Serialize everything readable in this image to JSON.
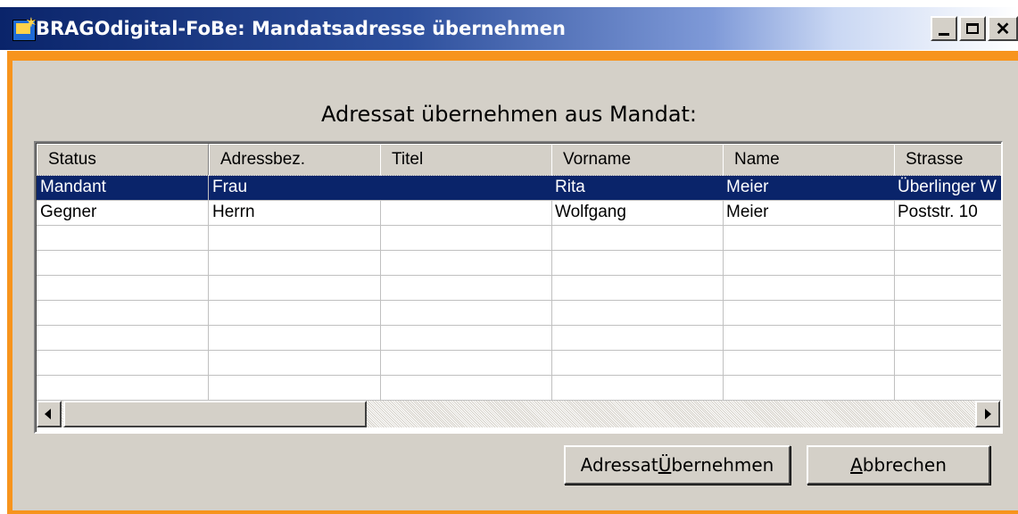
{
  "window": {
    "title": "BRAGOdigital-FoBe: Mandatsadresse übernehmen",
    "app_icon": "app-tv-icon",
    "controls": [
      "minimize-icon",
      "maximize-icon",
      "close-icon"
    ]
  },
  "dialog": {
    "heading": "Adressat übernehmen aus Mandat:"
  },
  "table": {
    "columns": [
      "Status",
      "Adressbez.",
      "Titel",
      "Vorname",
      "Name",
      "Strasse"
    ],
    "rows": [
      [
        "Mandant",
        "Frau",
        "",
        "Rita",
        "Meier",
        "Überlinger W"
      ],
      [
        "Gegner",
        "Herrn",
        "",
        "Wolfgang",
        "Meier",
        "Poststr. 10"
      ],
      [
        "",
        "",
        "",
        "",
        "",
        ""
      ],
      [
        "",
        "",
        "",
        "",
        "",
        ""
      ],
      [
        "",
        "",
        "",
        "",
        "",
        ""
      ],
      [
        "",
        "",
        "",
        "",
        "",
        ""
      ],
      [
        "",
        "",
        "",
        "",
        "",
        ""
      ],
      [
        "",
        "",
        "",
        "",
        "",
        ""
      ],
      [
        "",
        "",
        "",
        "",
        "",
        ""
      ]
    ],
    "selected_row": 0
  },
  "buttons": {
    "accept_label_pre": "Adressat ",
    "accept_label_mnemonic": "Ü",
    "accept_label_post": "bernehmen",
    "cancel_label_mnemonic": "A",
    "cancel_label_post": "bbrechen"
  },
  "colors": {
    "frame": "#f7941d",
    "selection": "#0a246a",
    "face": "#d4d0c8"
  }
}
